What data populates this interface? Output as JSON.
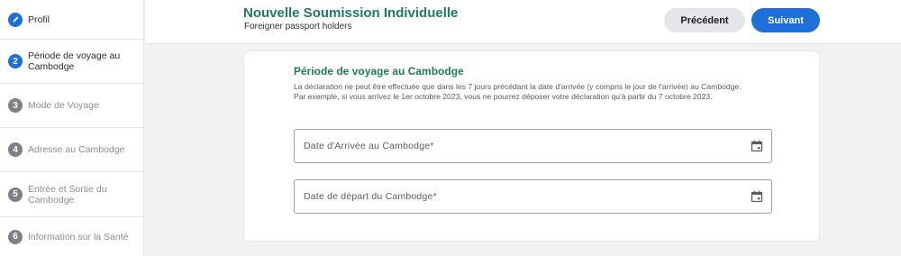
{
  "sidebar": {
    "steps": [
      {
        "number": "",
        "label": "Profil",
        "state": "done"
      },
      {
        "number": "2",
        "label": "Période de voyage au Cambodge",
        "state": "active"
      },
      {
        "number": "3",
        "label": "Mode de Voyage",
        "state": "todo"
      },
      {
        "number": "4",
        "label": "Adresse au Cambodge",
        "state": "todo"
      },
      {
        "number": "5",
        "label": "Entrée et Sortie du Cambodge",
        "state": "todo"
      },
      {
        "number": "6",
        "label": "Information sur la Santé",
        "state": "todo"
      }
    ]
  },
  "header": {
    "title": "Nouvelle Soumission Individuelle",
    "subtitle": "Foreigner passport holders",
    "prev_label": "Précédent",
    "next_label": "Suivant"
  },
  "form": {
    "section_title": "Période de voyage au Cambodge",
    "info_line1": "La déclaration ne peut être effectuée que dans les 7 jours précédant la date d'arrivée (y compris le jour de l'arrivée) au Cambodge.",
    "info_line2": "Par exemple, si vous arrivez le 1er octobre 2023, vous ne pourrez déposer votre déclaration qu'à partir du 7 octobre 2023.",
    "arrival_label": "Date d'Arrivée au Cambodge*",
    "departure_label": "Date de départ du Cambodge*"
  },
  "colors": {
    "accent_green": "#1f7d5c",
    "primary_blue": "#1e6fd9",
    "inactive_step": "#7d8085"
  },
  "icons": {
    "step1": "pencil-icon",
    "date_fields": "calendar-icon"
  }
}
